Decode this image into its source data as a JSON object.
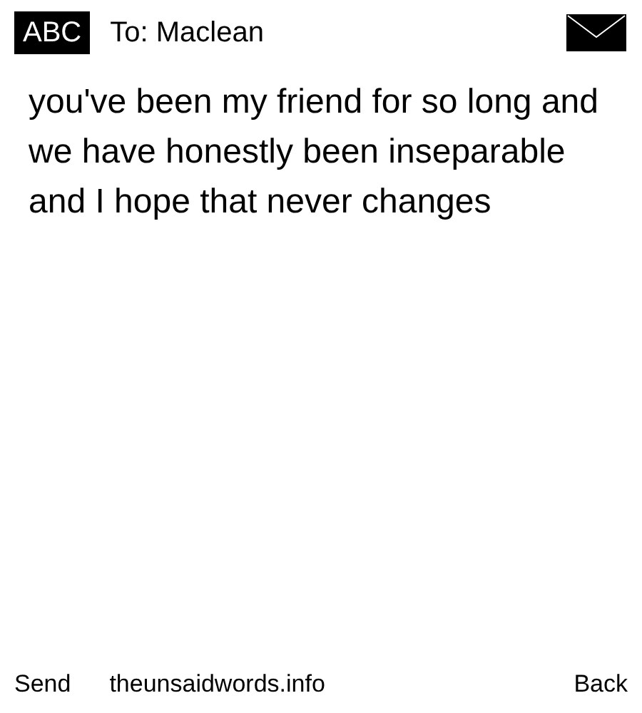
{
  "header": {
    "input_mode": "ABC",
    "recipient": "To: Maclean"
  },
  "message": "you've been my friend for so long and we have honestly been inseparable and I hope that never changes",
  "softkeys": {
    "left": "Send",
    "center": "theunsaidwords.info",
    "right": "Back"
  }
}
